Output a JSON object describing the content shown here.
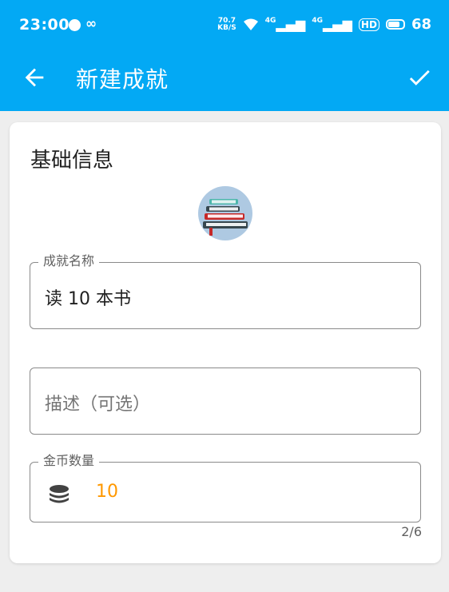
{
  "status_bar": {
    "time": "23:00",
    "netspeed_value": "70.7",
    "netspeed_unit": "KB/S",
    "signal1": "4G",
    "signal2": "4G",
    "hd": "HD",
    "battery": "68"
  },
  "toolbar": {
    "title": "新建成就"
  },
  "form": {
    "section_title": "基础信息",
    "name_field": {
      "label": "成就名称",
      "value": "读 10 本书"
    },
    "description_field": {
      "placeholder": "描述（可选）"
    },
    "coins_field": {
      "label": "金币数量",
      "value": "10",
      "counter": "2/6"
    }
  },
  "colors": {
    "primary": "#03a9f4",
    "coins": "#ff9800"
  },
  "icons": [
    "back-arrow-icon",
    "check-icon",
    "books-icon",
    "coins-icon",
    "wifi-icon",
    "signal-icon",
    "battery-icon"
  ]
}
